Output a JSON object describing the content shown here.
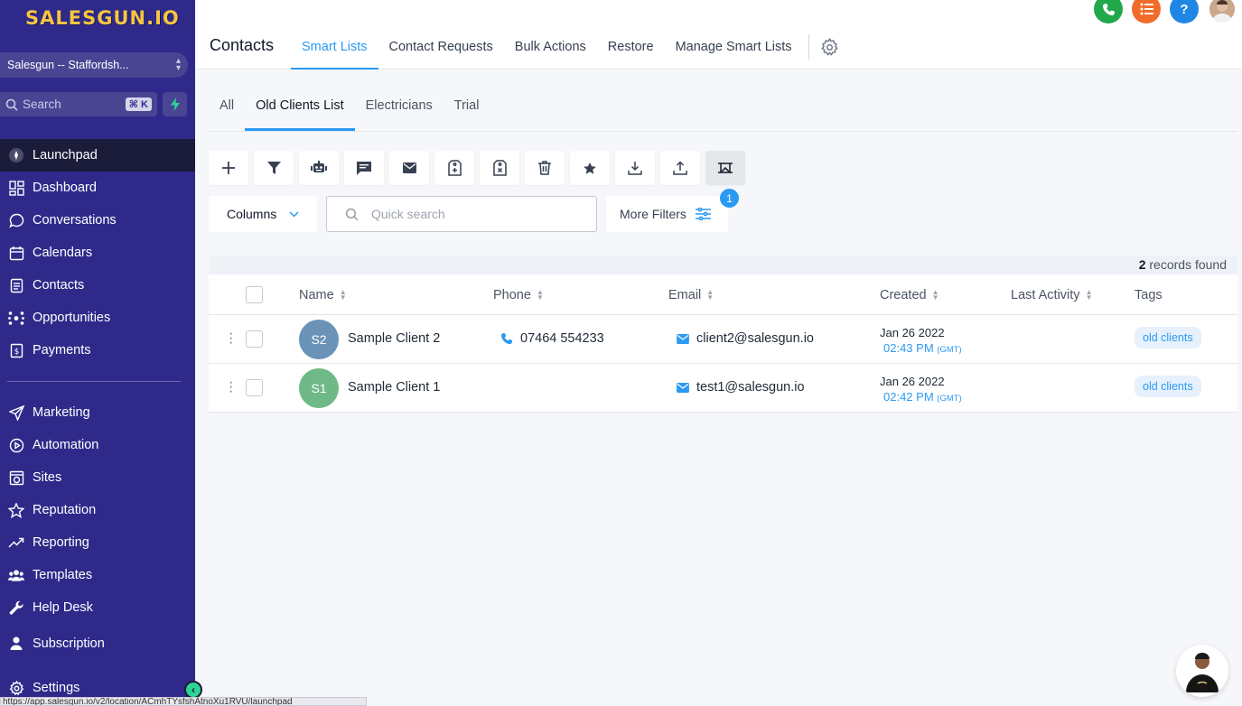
{
  "sidebar": {
    "logo": "SALESGUN.IO",
    "account": "Salesgun -- Staffordsh...",
    "search": {
      "label": "Search",
      "shortcut": "⌘ K"
    },
    "items_top": [
      {
        "label": "Launchpad",
        "icon": "launchpad-icon",
        "active": true
      },
      {
        "label": "Dashboard",
        "icon": "dashboard-icon"
      },
      {
        "label": "Conversations",
        "icon": "chat-bubble-icon"
      },
      {
        "label": "Calendars",
        "icon": "calendar-icon"
      },
      {
        "label": "Contacts",
        "icon": "contacts-icon"
      },
      {
        "label": "Opportunities",
        "icon": "opportunities-icon"
      },
      {
        "label": "Payments",
        "icon": "payments-icon"
      }
    ],
    "items_bottom": [
      {
        "label": "Marketing",
        "icon": "send-icon"
      },
      {
        "label": "Automation",
        "icon": "automation-icon"
      },
      {
        "label": "Sites",
        "icon": "sites-icon"
      },
      {
        "label": "Reputation",
        "icon": "star-icon"
      },
      {
        "label": "Reporting",
        "icon": "trend-icon"
      },
      {
        "label": "Templates",
        "icon": "templates-icon"
      },
      {
        "label": "Help Desk",
        "icon": "wrench-icon"
      },
      {
        "label": "Subscription",
        "icon": "subscription-icon"
      }
    ],
    "settings": "Settings",
    "status_url": "https://app.salesgun.io/v2/location/ACmhTYsfshAtnoXu1RVU/launchpad"
  },
  "header": {
    "title": "Contacts",
    "tabs": [
      "Smart Lists",
      "Contact Requests",
      "Bulk Actions",
      "Restore",
      "Manage Smart Lists"
    ],
    "active_tab": 0,
    "help_label": "?"
  },
  "subtabs": {
    "items": [
      "All",
      "Old Clients List",
      "Electricians",
      "Trial"
    ],
    "active": 1
  },
  "filters": {
    "columns_label": "Columns",
    "quick_search_placeholder": "Quick search",
    "more_filters_label": "More Filters",
    "badge_count": "1"
  },
  "table": {
    "records_count": "2",
    "records_label": " records found",
    "columns": [
      "Name",
      "Phone",
      "Email",
      "Created",
      "Last Activity",
      "Tags"
    ],
    "rows": [
      {
        "initials": "S2",
        "avatar_color": "#6b93b8",
        "name": "Sample Client 2",
        "phone": "07464 554233",
        "email": "client2@salesgun.io",
        "created_date": "Jan 26 2022",
        "created_time": "02:43 PM",
        "tz": "(GMT)",
        "tag": "old clients"
      },
      {
        "initials": "S1",
        "avatar_color": "#6fb987",
        "name": "Sample Client 1",
        "phone": "",
        "email": "test1@salesgun.io",
        "created_date": "Jan 26 2022",
        "created_time": "02:42 PM",
        "tz": "(GMT)",
        "tag": "old clients"
      }
    ]
  },
  "colors": {
    "sidebar": "#2f2a8a",
    "accent": "#2b9af3",
    "phone_green": "#21a84a",
    "list_orange": "#f26b2a",
    "help_blue": "#1f86e5"
  }
}
